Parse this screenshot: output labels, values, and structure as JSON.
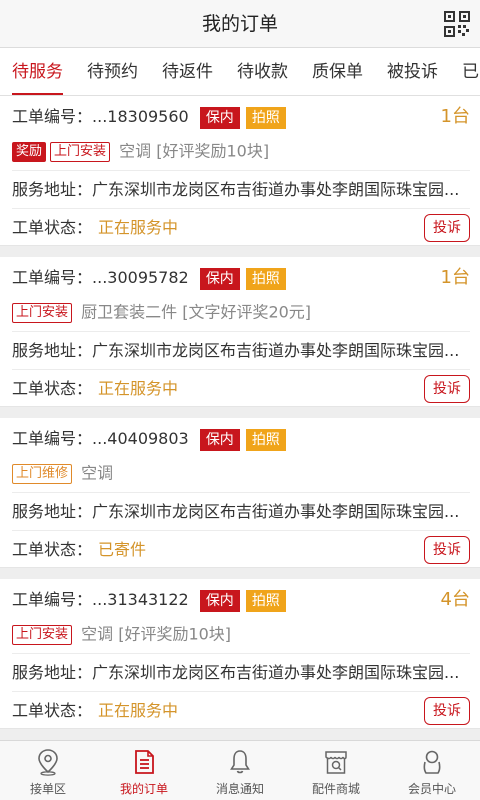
{
  "header": {
    "title": "我的订单",
    "right_icon": "qr-code-icon"
  },
  "tabs": [
    {
      "label": "待服务",
      "active": true
    },
    {
      "label": "待预约",
      "active": false
    },
    {
      "label": "待返件",
      "active": false
    },
    {
      "label": "待收款",
      "active": false
    },
    {
      "label": "质保单",
      "active": false
    },
    {
      "label": "被投诉",
      "active": false
    },
    {
      "label": "已",
      "active": false
    }
  ],
  "orders": [
    {
      "order_label": "工单编号：",
      "order_no": "...18309560",
      "badge_warranty": "保内",
      "badge_photo": "拍照",
      "quantity": "1台",
      "tags": [
        "奖励",
        "上门安装"
      ],
      "service": "空调 [好评奖励10块]",
      "address_label": "服务地址：",
      "address": "广东深圳市龙岗区布吉街道办事处李朗国际珠宝园...",
      "status_label": "工单状态：",
      "status": "正在服务中",
      "complain_label": "投诉"
    },
    {
      "order_label": "工单编号：",
      "order_no": "...30095782",
      "badge_warranty": "保内",
      "badge_photo": "拍照",
      "quantity": "1台",
      "tags": [
        "上门安装"
      ],
      "service": "厨卫套装二件 [文字好评奖20元]",
      "address_label": "服务地址：",
      "address": "广东深圳市龙岗区布吉街道办事处李朗国际珠宝园...",
      "status_label": "工单状态：",
      "status": "正在服务中",
      "complain_label": "投诉"
    },
    {
      "order_label": "工单编号：",
      "order_no": "...40409803",
      "badge_warranty": "保内",
      "badge_photo": "拍照",
      "quantity": "",
      "tags": [
        "上门维修"
      ],
      "service": "空调",
      "address_label": "服务地址：",
      "address": "广东深圳市龙岗区布吉街道办事处李朗国际珠宝园...",
      "status_label": "工单状态：",
      "status": "已寄件",
      "complain_label": "投诉"
    },
    {
      "order_label": "工单编号：",
      "order_no": "...31343122",
      "badge_warranty": "保内",
      "badge_photo": "拍照",
      "quantity": "4台",
      "tags": [
        "上门安装"
      ],
      "service": "空调 [好评奖励10块]",
      "address_label": "服务地址：",
      "address": "广东深圳市龙岗区布吉街道办事处李朗国际珠宝园...",
      "status_label": "工单状态：",
      "status": "正在服务中",
      "complain_label": "投诉"
    }
  ],
  "tabbar": [
    {
      "label": "接单区",
      "icon": "location-pin-icon",
      "active": false
    },
    {
      "label": "我的订单",
      "icon": "order-list-icon",
      "active": true
    },
    {
      "label": "消息通知",
      "icon": "bell-icon",
      "active": false
    },
    {
      "label": "配件商城",
      "icon": "store-icon",
      "active": false
    },
    {
      "label": "会员中心",
      "icon": "user-icon",
      "active": false
    }
  ],
  "colors": {
    "accent": "#c8161d",
    "gold": "#f0a41a",
    "status": "#d4942a"
  }
}
